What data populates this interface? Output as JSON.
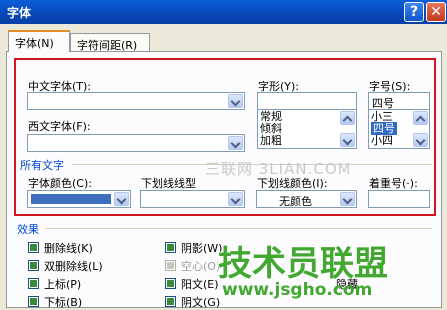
{
  "window": {
    "title": "字体",
    "help_label": "?",
    "close_label": "✕"
  },
  "tabs": [
    {
      "label": "字体(N)",
      "active": true
    },
    {
      "label": "字符间距(R)",
      "active": false
    }
  ],
  "font_panel": {
    "chinese_font_label": "中文字体(T):",
    "chinese_font_value": "",
    "western_font_label": "西文字体(F):",
    "western_font_value": "",
    "style_label": "字形(Y):",
    "style_value": "",
    "style_options": [
      "常规",
      "倾斜",
      "加粗"
    ],
    "size_label": "字号(S):",
    "size_value": "四号",
    "size_options": [
      "小三",
      "四号",
      "小四"
    ],
    "size_selected": "四号"
  },
  "all_text": {
    "group_label": "所有文字",
    "font_color_label": "字体颜色(C):",
    "font_color_value": "#3e6fbf",
    "underline_style_label": "下划线线型",
    "underline_style_value": "",
    "underline_color_label": "下划线颜色(I):",
    "underline_color_value": "无颜色",
    "emphasis_label": "着重号(·):",
    "emphasis_value": ""
  },
  "effects": {
    "group_label": "效果",
    "items": [
      {
        "label": "删除线(K)",
        "dim": false
      },
      {
        "label": "双删除线(L)",
        "dim": false
      },
      {
        "label": "上标(P)",
        "dim": false
      },
      {
        "label": "下标(B)",
        "dim": false
      },
      {
        "label": "阴影(W)",
        "dim": false
      },
      {
        "label": "空心(O)",
        "dim": true
      },
      {
        "label": "阳文(E)",
        "dim": false
      },
      {
        "label": "阴文(G)",
        "dim": false
      },
      {
        "label": "隐藏",
        "dim": false
      }
    ]
  },
  "watermark": {
    "text": "三联网 3LIAN.COM",
    "logo_text": "技术员联盟",
    "logo_url": "www.jsgho.com"
  },
  "colors": {
    "accent": "#d0161f",
    "group_title": "#0046d5",
    "logo": "#43a831"
  }
}
